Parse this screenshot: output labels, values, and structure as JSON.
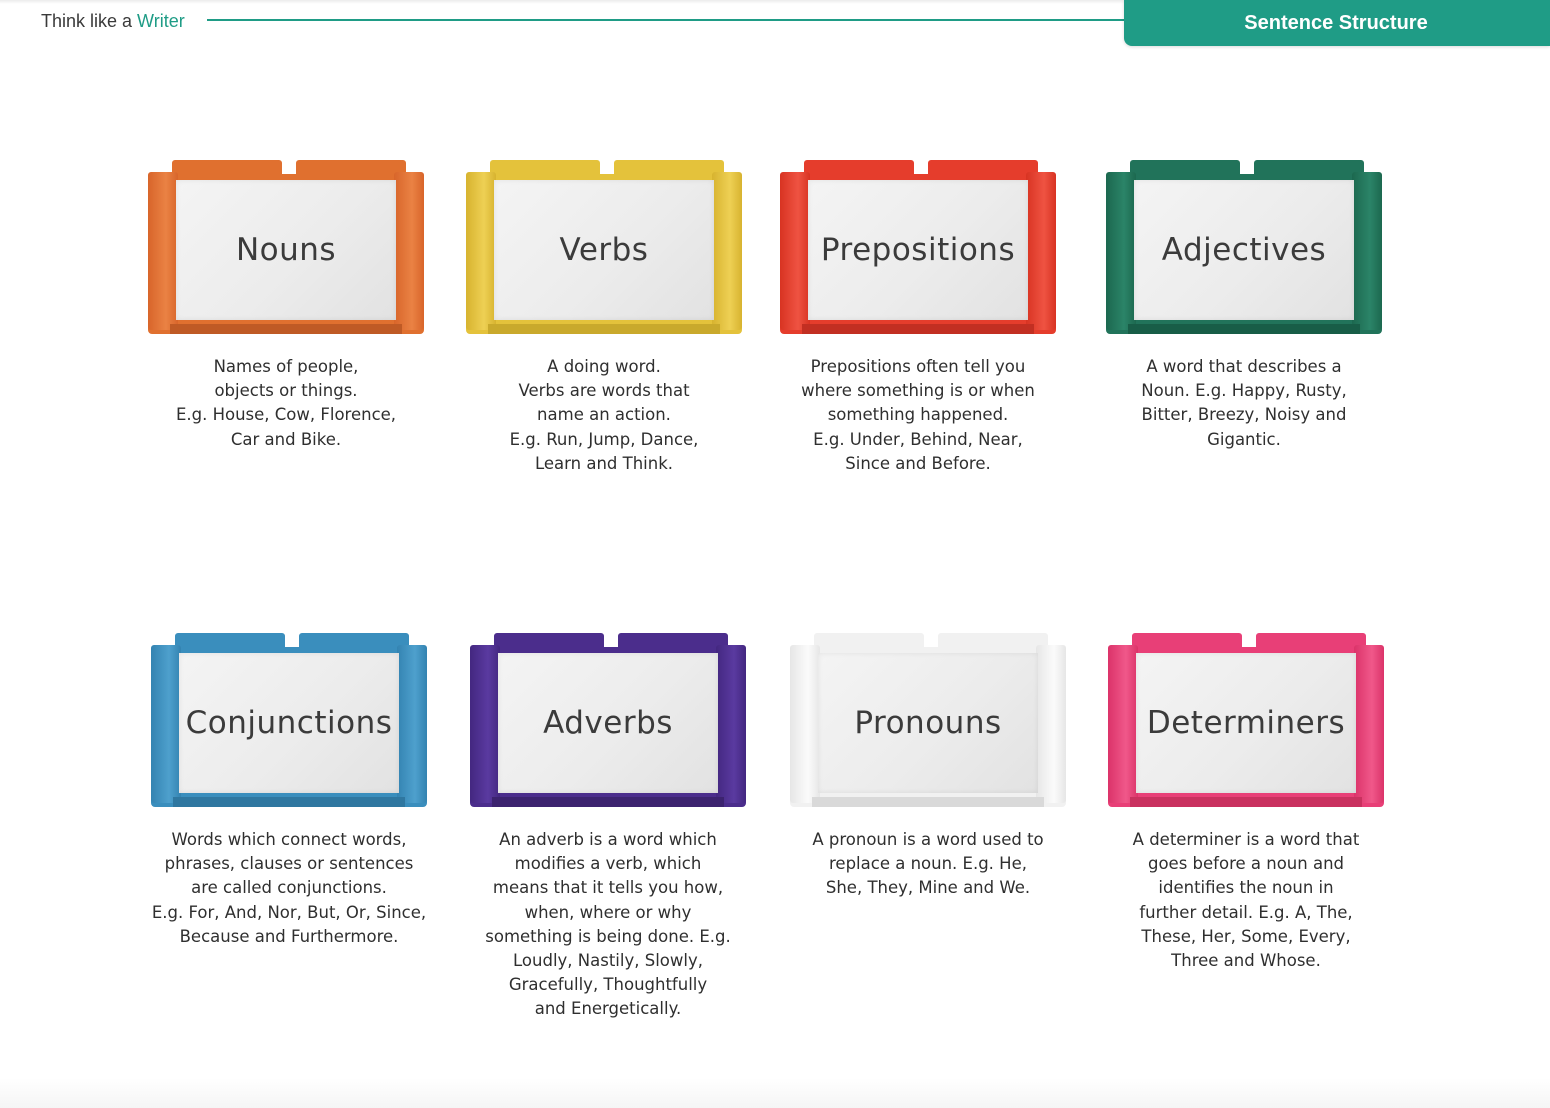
{
  "header": {
    "brand_prefix": "Think like a ",
    "brand_accent": "Writer",
    "section_title": "Sentence Structure"
  },
  "colors": {
    "accent": "#1f9c86",
    "nouns": "#e0702f",
    "verbs": "#e4c23b",
    "prepositions": "#e53d2c",
    "adjectives": "#21735a",
    "conjunctions": "#3a8ebd",
    "adverbs": "#4b2d8c",
    "pronouns": "#f1f1f1",
    "determiners": "#e83f77"
  },
  "cards": [
    {
      "title": "Nouns",
      "description": "Names of people,\nobjects or things.\nE.g. House, Cow, Florence,\nCar and Bike."
    },
    {
      "title": "Verbs",
      "description": "A doing word.\nVerbs are words that\nname an action.\nE.g. Run, Jump, Dance,\nLearn and Think."
    },
    {
      "title": "Prepositions",
      "description": "Prepositions often tell you\nwhere something is or when\nsomething happened.\nE.g. Under, Behind, Near,\nSince and Before."
    },
    {
      "title": "Adjectives",
      "description": "A word that describes a\nNoun. E.g. Happy, Rusty,\nBitter, Breezy, Noisy and\nGigantic."
    },
    {
      "title": "Conjunctions",
      "description": "Words which connect words,\nphrases, clauses or sentences\nare called conjunctions.\nE.g. For, And, Nor, But, Or, Since,\nBecause and Furthermore."
    },
    {
      "title": "Adverbs",
      "description": "An adverb is a word which\nmodifies a verb, which\nmeans that it tells you how,\nwhen, where or why\nsomething is being done. E.g.\nLoudly, Nastily, Slowly,\nGracefully, Thoughtfully\nand Energetically."
    },
    {
      "title": "Pronouns",
      "description": "A pronoun is a word used to\nreplace a noun. E.g. He,\nShe, They, Mine and We."
    },
    {
      "title": "Determiners",
      "description": "A determiner is a word that\ngoes before a noun and\nidentifies the noun in\nfurther detail. E.g. A, The,\nThese, Her, Some, Every,\nThree and Whose."
    }
  ]
}
